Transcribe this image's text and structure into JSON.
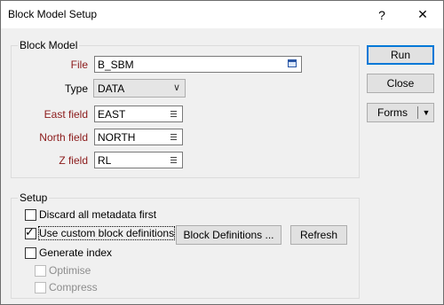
{
  "window": {
    "title": "Block Model Setup",
    "help_glyph": "?",
    "close_glyph": "✕"
  },
  "block_model": {
    "legend": "Block Model",
    "file": {
      "label": "File",
      "value": "B_SBM",
      "icon": "browse-icon"
    },
    "type": {
      "label": "Type",
      "value": "DATA",
      "icon": "chevron-down-icon"
    },
    "east_field": {
      "label": "East field",
      "value": "EAST",
      "icon": "list-icon"
    },
    "north_field": {
      "label": "North field",
      "value": "NORTH",
      "icon": "list-icon"
    },
    "z_field": {
      "label": "Z field",
      "value": "RL",
      "icon": "list-icon"
    }
  },
  "setup": {
    "legend": "Setup",
    "discard_metadata": {
      "label": "Discard all metadata first",
      "checked": false
    },
    "use_custom_block_definitions": {
      "label": "Use custom block definitions",
      "checked": true
    },
    "block_definitions_button": "Block Definitions ...",
    "refresh_button": "Refresh",
    "generate_index": {
      "label": "Generate index",
      "checked": false
    },
    "optimise": {
      "label": "Optimise",
      "checked": false,
      "enabled": false
    },
    "compress": {
      "label": "Compress",
      "checked": false,
      "enabled": false
    }
  },
  "actions": {
    "run": "Run",
    "close": "Close",
    "forms": "Forms",
    "forms_arrow": "▼"
  },
  "colors": {
    "required_label": "#8b1a1a",
    "primary_border": "#0078d7",
    "dialog_bg": "#f0f0f0"
  }
}
